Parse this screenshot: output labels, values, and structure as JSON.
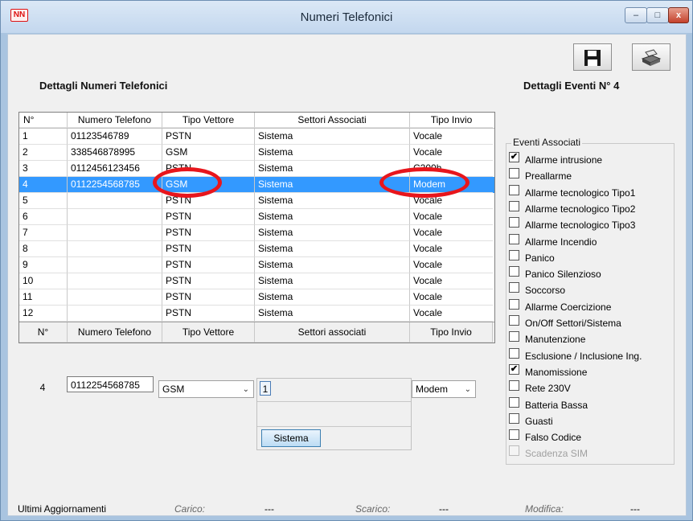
{
  "window": {
    "title": "Numeri Telefonici",
    "app_icon": "NN"
  },
  "window_controls": {
    "minimize": "–",
    "maximize": "□",
    "close": "x"
  },
  "toolbar": {
    "save_icon": "floppy-disk-icon",
    "print_icon": "printer-icon"
  },
  "sections": {
    "left_title": "Dettagli Numeri Telefonici",
    "right_title": "Dettagli Eventi N° 4"
  },
  "grid": {
    "headers": [
      "N°",
      "Numero Telefono",
      "Tipo Vettore",
      "Settori Associati",
      "Tipo Invio"
    ],
    "rows": [
      [
        "1",
        "01123546789",
        "PSTN",
        "Sistema",
        "Vocale"
      ],
      [
        "2",
        "338546878995",
        "GSM",
        "Sistema",
        "Vocale"
      ],
      [
        "3",
        "0112456123456",
        "PSTN",
        "Sistema",
        "C200h"
      ],
      [
        "4",
        "0112254568785",
        "GSM",
        "Sistema",
        "Modem"
      ],
      [
        "5",
        "",
        "PSTN",
        "Sistema",
        "Vocale"
      ],
      [
        "6",
        "",
        "PSTN",
        "Sistema",
        "Vocale"
      ],
      [
        "7",
        "",
        "PSTN",
        "Sistema",
        "Vocale"
      ],
      [
        "8",
        "",
        "PSTN",
        "Sistema",
        "Vocale"
      ],
      [
        "9",
        "",
        "PSTN",
        "Sistema",
        "Vocale"
      ],
      [
        "10",
        "",
        "PSTN",
        "Sistema",
        "Vocale"
      ],
      [
        "11",
        "",
        "PSTN",
        "Sistema",
        "Vocale"
      ],
      [
        "12",
        "",
        "PSTN",
        "Sistema",
        "Vocale"
      ]
    ],
    "selected_row": 4
  },
  "editor": {
    "headers": [
      "N°",
      "Numero Telefono",
      "Tipo Vettore",
      "Settori associati",
      "Tipo Invio"
    ],
    "number": "4",
    "phone": "0112254568785",
    "vettore": "GSM",
    "settore_chip": "1",
    "invio": "Modem",
    "sistema_button": "Sistema"
  },
  "events": {
    "legend": "Eventi Associati",
    "items": [
      {
        "label": "Allarme intrusione",
        "checked": true
      },
      {
        "label": "Preallarme",
        "checked": false
      },
      {
        "label": "Allarme tecnologico Tipo1",
        "checked": false
      },
      {
        "label": "Allarme tecnologico Tipo2",
        "checked": false
      },
      {
        "label": "Allarme tecnologico Tipo3",
        "checked": false
      },
      {
        "label": "Allarme Incendio",
        "checked": false
      },
      {
        "label": "Panico",
        "checked": false
      },
      {
        "label": "Panico Silenzioso",
        "checked": false
      },
      {
        "label": "Soccorso",
        "checked": false
      },
      {
        "label": "Allarme Coercizione",
        "checked": false
      },
      {
        "label": "On/Off Settori/Sistema",
        "checked": false
      },
      {
        "label": "Manutenzione",
        "checked": false
      },
      {
        "label": "Esclusione / Inclusione Ing.",
        "checked": false
      },
      {
        "label": "Manomissione",
        "checked": true
      },
      {
        "label": "Rete 230V",
        "checked": false
      },
      {
        "label": "Batteria Bassa",
        "checked": false
      },
      {
        "label": "Guasti",
        "checked": false
      },
      {
        "label": "Falso Codice",
        "checked": false
      },
      {
        "label": "Scadenza SIM",
        "checked": false,
        "disabled": true
      }
    ]
  },
  "status": {
    "label": "Ultimi Aggiornamenti",
    "carico_label": "Carico:",
    "carico_value": "---",
    "scarico_label": "Scarico:",
    "scarico_value": "---",
    "modifica_label": "Modifica:",
    "modifica_value": "---"
  },
  "colors": {
    "selection": "#3399ff",
    "highlight_oval": "#e8161c"
  }
}
